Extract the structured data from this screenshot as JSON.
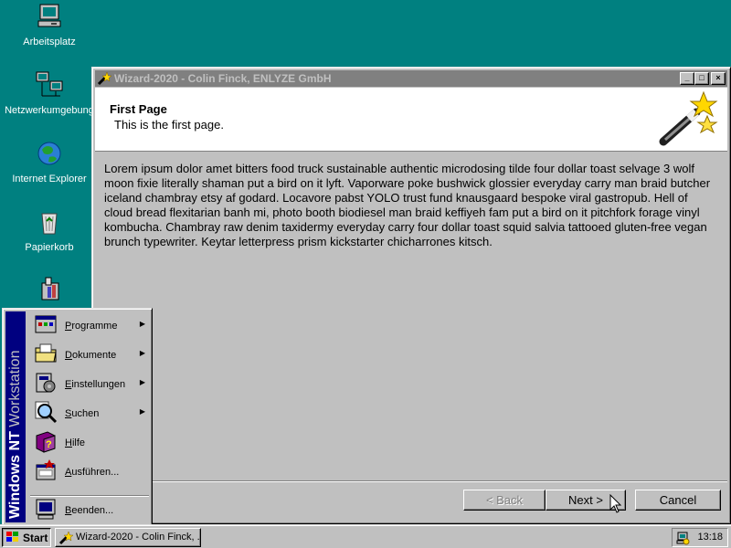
{
  "desktop": {
    "icons": [
      {
        "label": "Arbeitsplatz",
        "icon": "computer-icon"
      },
      {
        "label": "Netzwerkumgebung",
        "icon": "network-icon"
      },
      {
        "label": "Internet Explorer",
        "icon": "internet-explorer-icon"
      },
      {
        "label": "Papierkorb",
        "icon": "recycle-bin-icon"
      },
      {
        "label": "",
        "icon": "briefcase-icon"
      }
    ]
  },
  "window": {
    "title": "Wizard-2020 - Colin Finck, ENLYZE GmbH",
    "header_title": "First Page",
    "header_subtitle": "This is the first page.",
    "body": "Lorem ipsum dolor amet bitters food truck sustainable authentic microdosing tilde four dollar toast selvage 3 wolf moon fixie literally shaman put a bird on it lyft. Vaporware poke bushwick glossier everyday carry man braid butcher iceland chambray etsy af godard. Locavore pabst YOLO trust fund knausgaard bespoke viral gastropub. Hell of cloud bread flexitarian banh mi, photo booth biodiesel man braid keffiyeh fam put a bird on it pitchfork forage vinyl kombucha. Chambray raw denim taxidermy everyday carry four dollar toast squid salvia tattooed gluten-free vegan brunch typewriter. Keytar letterpress prism kickstarter chicharrones kitsch.",
    "buttons": {
      "back": "< Back",
      "next": "Next >",
      "cancel": "Cancel"
    },
    "controls": {
      "minimize": "_",
      "maximize": "□",
      "close": "×"
    }
  },
  "startmenu": {
    "banner_bold": "Windows NT",
    "banner_thin": " Workstation",
    "items": [
      {
        "label": "Programme",
        "underline": "P",
        "rest": "rogramme",
        "submenu": true,
        "icon": "programs-icon"
      },
      {
        "label": "Dokumente",
        "underline": "D",
        "rest": "okumente",
        "submenu": true,
        "icon": "documents-icon"
      },
      {
        "label": "Einstellungen",
        "underline": "E",
        "rest": "instellungen",
        "submenu": true,
        "icon": "settings-icon"
      },
      {
        "label": "Suchen",
        "underline": "S",
        "rest": "uchen",
        "submenu": true,
        "icon": "find-icon"
      },
      {
        "label": "Hilfe",
        "underline": "H",
        "rest": "ilfe",
        "submenu": false,
        "icon": "help-icon"
      },
      {
        "label": "Ausführen...",
        "underline": "A",
        "rest": "usführen...",
        "submenu": false,
        "icon": "run-icon"
      },
      {
        "label": "Beenden...",
        "underline": "B",
        "rest": "eenden...",
        "submenu": false,
        "icon": "shutdown-icon"
      }
    ],
    "arrow": "▶"
  },
  "taskbar": {
    "start_label": "Start",
    "task_label": "Wizard-2020 - Colin Finck, ...",
    "clock": "13:18"
  }
}
